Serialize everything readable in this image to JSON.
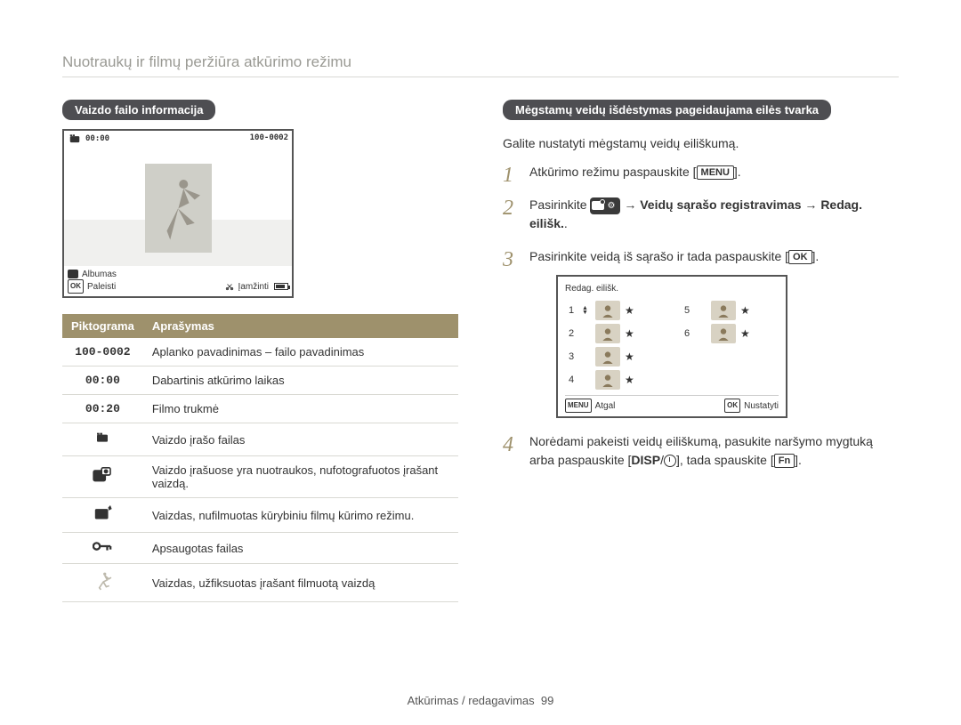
{
  "page_header": "Nuotraukų ir filmų peržiūra atkūrimo režimu",
  "left": {
    "section_title": "Vaizdo failo informacija",
    "camera": {
      "folder_file": "100-0002",
      "time_current": "00:00",
      "album_label": "Albumas",
      "ok_hint": "OK",
      "play_label": "Paleisti",
      "trim_label": "Įamžinti"
    },
    "table_headers": {
      "icon": "Piktograma",
      "desc": "Aprašymas"
    },
    "rows": [
      {
        "icon": "100-0002",
        "desc": "Aplanko pavadinimas – failo pavadinimas"
      },
      {
        "icon": "00:00",
        "desc": "Dabartinis atkūrimo laikas"
      },
      {
        "icon": "00:20",
        "desc": "Filmo trukmė"
      },
      {
        "icon": "movie",
        "desc": "Vaizdo įrašo failas"
      },
      {
        "icon": "movie-photo",
        "desc": "Vaizdo įrašuose yra nuotraukos, nufotografuotos įrašant vaizdą."
      },
      {
        "icon": "creative-movie",
        "desc": "Vaizdas, nufilmuotas kūrybiniu filmų kūrimo režimu."
      },
      {
        "icon": "key",
        "desc": "Apsaugotas failas"
      },
      {
        "icon": "skater",
        "desc": "Vaizdas, užfiksuotas įrašant filmuotą vaizdą"
      }
    ]
  },
  "right": {
    "section_title": "Mėgstamų veidų išdėstymas pageidaujama eilės tvarka",
    "intro": "Galite nustatyti mėgstamų veidų eiliškumą.",
    "step1_text": "Atkūrimo režimu paspauskite [",
    "step1_btn": "MENU",
    "step1_after": "].",
    "step2_pre": "Pasirinkite ",
    "step2_mid": " → ",
    "step2_bold": "Veidų sąrašo registravimas → Redag. eilišk.",
    "step2_after": ".",
    "step3_pre": "Pasirinkite veidą iš sąrašo ir tada paspauskite [",
    "step3_btn": "OK",
    "step3_after": "].",
    "rank_screen": {
      "title": "Redag. eilišk.",
      "left_nums": [
        "1",
        "2",
        "3",
        "4"
      ],
      "right_nums": [
        "5",
        "6"
      ],
      "back_btn": "MENU",
      "back_label": "Atgal",
      "set_btn": "OK",
      "set_label": "Nustatyti"
    },
    "step4_a": "Norėdami pakeisti veidų eiliškumą, pasukite naršymo mygtuką arba paspauskite [",
    "step4_disp": "DISP",
    "step4_sep": "/",
    "step4_b": "], tada spauskite [",
    "step4_fn": "Fn",
    "step4_c": "]."
  },
  "footer": {
    "text": "Atkūrimas / redagavimas",
    "page": "99"
  }
}
